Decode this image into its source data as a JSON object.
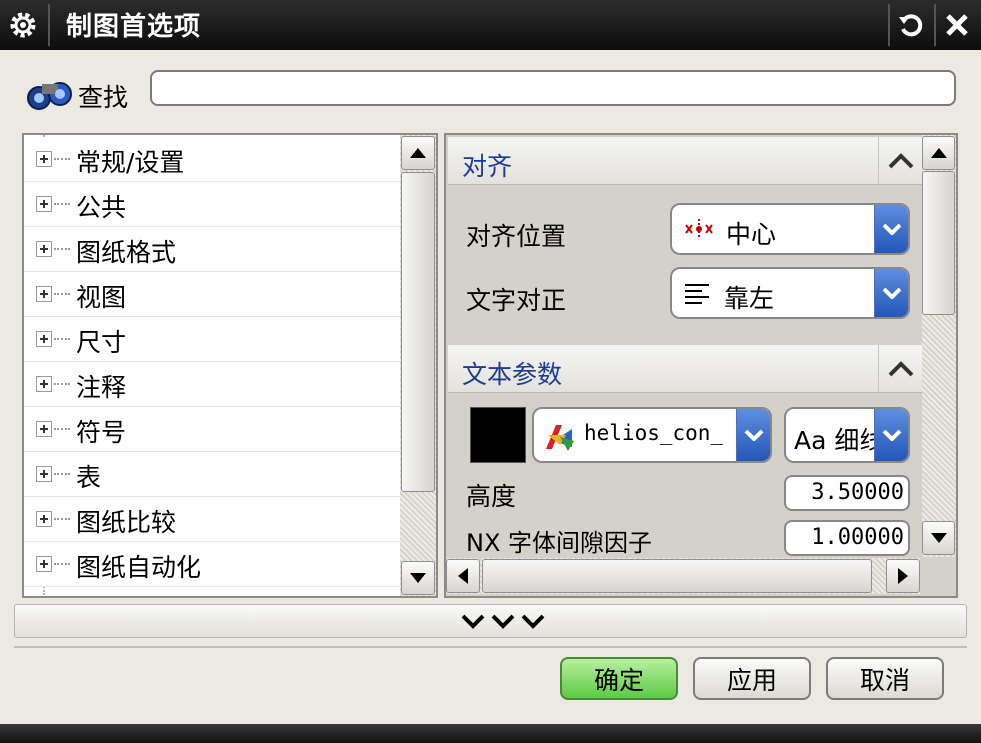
{
  "window": {
    "title": "制图首选项"
  },
  "find": {
    "label": "查找",
    "value": ""
  },
  "tree": {
    "items": [
      {
        "label": "常规/设置"
      },
      {
        "label": "公共"
      },
      {
        "label": "图纸格式"
      },
      {
        "label": "视图"
      },
      {
        "label": "尺寸"
      },
      {
        "label": "注释"
      },
      {
        "label": "符号"
      },
      {
        "label": "表"
      },
      {
        "label": "图纸比较"
      },
      {
        "label": "图纸自动化"
      }
    ]
  },
  "alignment": {
    "title": "对齐",
    "position_label": "对齐位置",
    "position_value": "中心",
    "justify_label": "文字对正",
    "justify_value": "靠左"
  },
  "text_params": {
    "title": "文本参数",
    "color": "#000000",
    "font_value": "helios_con_",
    "style_value": "Aa 细线",
    "height_label": "高度",
    "height_value": "3.50000",
    "spacing_label": "NX 字体间隙因子",
    "spacing_value": "1.00000"
  },
  "buttons": {
    "ok": "确定",
    "apply": "应用",
    "cancel": "取消"
  },
  "colors": {
    "ok_button": "#6fd355",
    "section_title": "#1a3c92",
    "dropdown_arrow": "#2f63c4"
  }
}
